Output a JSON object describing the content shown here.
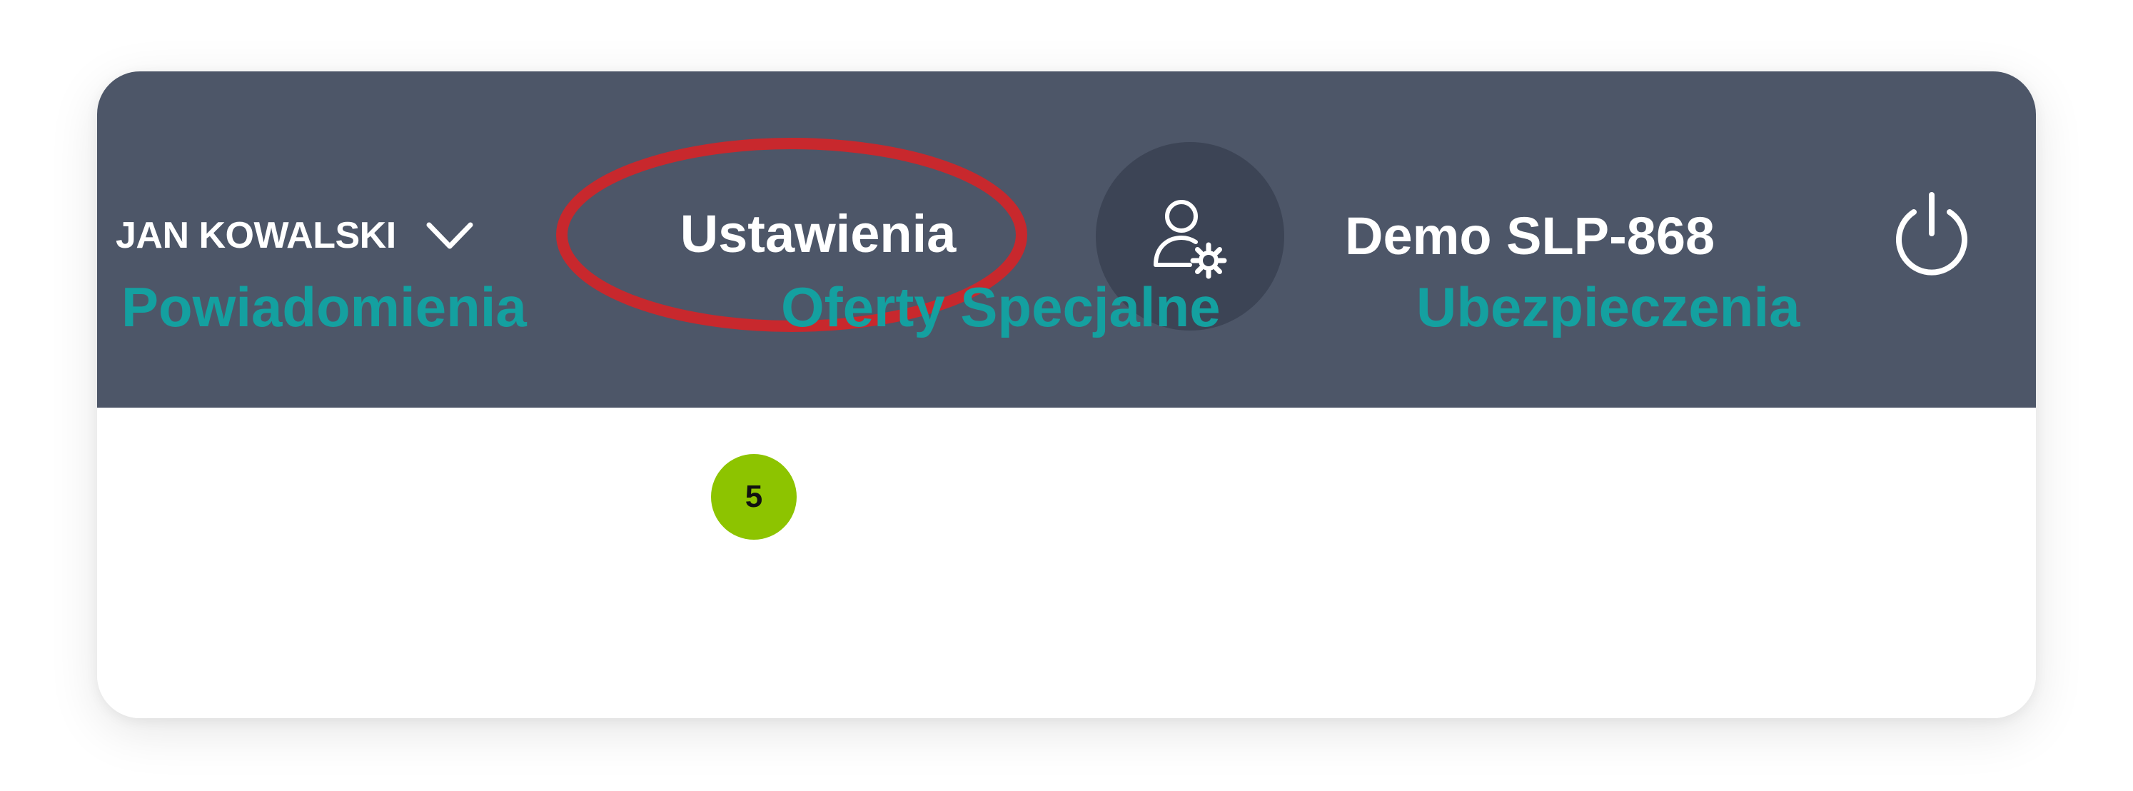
{
  "header": {
    "user_name": "JAN KOWALSKI",
    "settings_label": "Ustawienia",
    "environment_label": "Demo SLP-868",
    "icons": {
      "user_menu": "chevron-down-icon",
      "account": "user-gear-icon",
      "logout": "power-icon"
    }
  },
  "tabs": [
    {
      "label": "Powiadomienia"
    },
    {
      "label": "Oferty Specjalne",
      "badge": "5"
    },
    {
      "label": "Ubezpieczenia"
    }
  ],
  "colors": {
    "topbar": "#4d5668",
    "account_button": "#3c4455",
    "link": "#14a0a0",
    "badge": "#8dc400",
    "highlight": "#c8282d"
  }
}
